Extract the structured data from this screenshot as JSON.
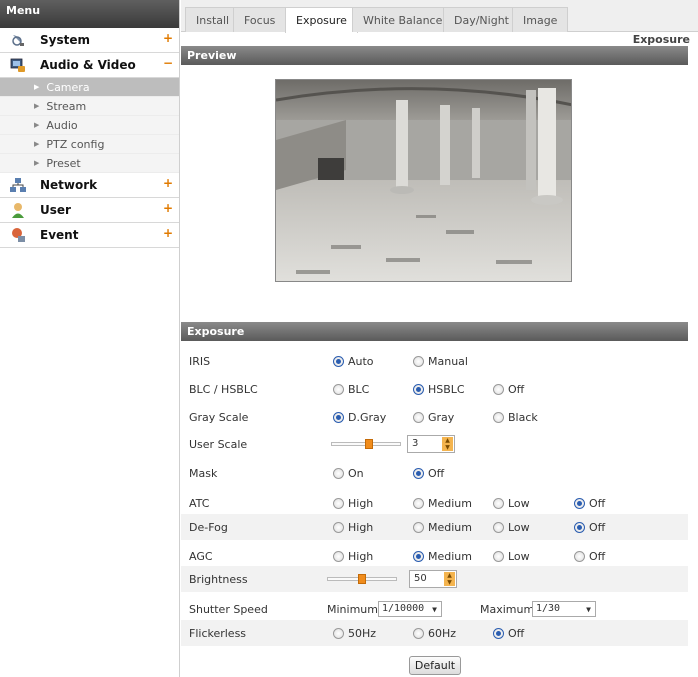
{
  "sidebar": {
    "header": "Menu",
    "categories": [
      {
        "label": "System",
        "toggle": "+"
      },
      {
        "label": "Audio & Video",
        "toggle": "−"
      },
      {
        "label": "Network",
        "toggle": "+"
      },
      {
        "label": "User",
        "toggle": "+"
      },
      {
        "label": "Event",
        "toggle": "+"
      }
    ],
    "sub_items": [
      "Camera",
      "Stream",
      "Audio",
      "PTZ config",
      "Preset"
    ]
  },
  "tabs": [
    "Install",
    "Focus",
    "Exposure",
    "White Balance",
    "Day/Night",
    "Image"
  ],
  "active_tab": "Exposure",
  "page_title": "Exposure",
  "preview": {
    "header": "Preview"
  },
  "exposure": {
    "header": "Exposure",
    "iris": {
      "label": "IRIS",
      "options": [
        "Auto",
        "Manual"
      ],
      "selected": "Auto"
    },
    "blc": {
      "label": "BLC / HSBLC",
      "options": [
        "BLC",
        "HSBLC",
        "Off"
      ],
      "selected": "HSBLC"
    },
    "gray_scale": {
      "label": "Gray Scale",
      "options": [
        "D.Gray",
        "Gray",
        "Black"
      ],
      "selected": "D.Gray"
    },
    "user_scale": {
      "label": "User Scale",
      "value": "3",
      "level_fraction": 0.55
    },
    "mask": {
      "label": "Mask",
      "options": [
        "On",
        "Off"
      ],
      "selected": "Off"
    },
    "atc": {
      "label": "ATC",
      "options": [
        "High",
        "Medium",
        "Low",
        "Off"
      ],
      "selected": "Off"
    },
    "defog": {
      "label": "De-Fog",
      "options": [
        "High",
        "Medium",
        "Low",
        "Off"
      ],
      "selected": "Off"
    },
    "agc": {
      "label": "AGC",
      "options": [
        "High",
        "Medium",
        "Low",
        "Off"
      ],
      "selected": "Medium"
    },
    "brightness": {
      "label": "Brightness",
      "value": "50",
      "level_fraction": 0.5
    },
    "shutter": {
      "label": "Shutter Speed",
      "min_label": "Minimum :",
      "min_value": "1/10000",
      "max_label": "Maximum :",
      "max_value": "1/30"
    },
    "flickerless": {
      "label": "Flickerless",
      "options": [
        "50Hz",
        "60Hz",
        "Off"
      ],
      "selected": "Off"
    },
    "default_button": "Default"
  },
  "colors": {
    "accent": "#f08c1c",
    "radio_selected": "#2a5db0"
  }
}
